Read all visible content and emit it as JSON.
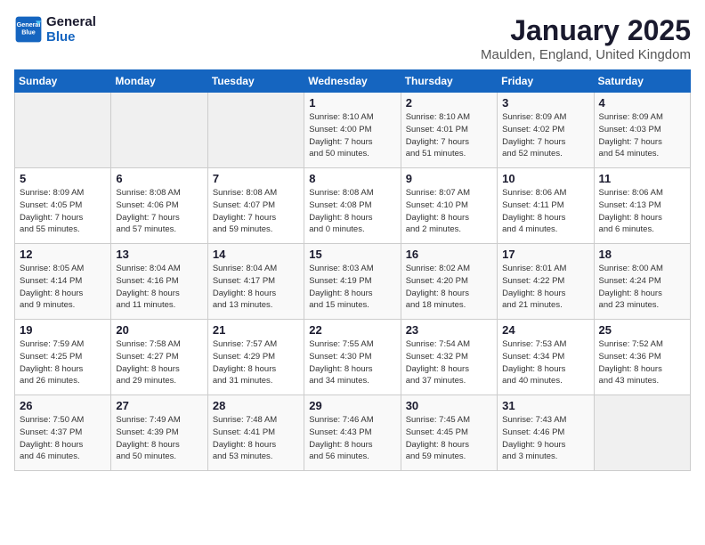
{
  "header": {
    "logo_line1": "General",
    "logo_line2": "Blue",
    "title": "January 2025",
    "subtitle": "Maulden, England, United Kingdom"
  },
  "days_of_week": [
    "Sunday",
    "Monday",
    "Tuesday",
    "Wednesday",
    "Thursday",
    "Friday",
    "Saturday"
  ],
  "weeks": [
    [
      {
        "day": "",
        "info": ""
      },
      {
        "day": "",
        "info": ""
      },
      {
        "day": "",
        "info": ""
      },
      {
        "day": "1",
        "info": "Sunrise: 8:10 AM\nSunset: 4:00 PM\nDaylight: 7 hours\nand 50 minutes."
      },
      {
        "day": "2",
        "info": "Sunrise: 8:10 AM\nSunset: 4:01 PM\nDaylight: 7 hours\nand 51 minutes."
      },
      {
        "day": "3",
        "info": "Sunrise: 8:09 AM\nSunset: 4:02 PM\nDaylight: 7 hours\nand 52 minutes."
      },
      {
        "day": "4",
        "info": "Sunrise: 8:09 AM\nSunset: 4:03 PM\nDaylight: 7 hours\nand 54 minutes."
      }
    ],
    [
      {
        "day": "5",
        "info": "Sunrise: 8:09 AM\nSunset: 4:05 PM\nDaylight: 7 hours\nand 55 minutes."
      },
      {
        "day": "6",
        "info": "Sunrise: 8:08 AM\nSunset: 4:06 PM\nDaylight: 7 hours\nand 57 minutes."
      },
      {
        "day": "7",
        "info": "Sunrise: 8:08 AM\nSunset: 4:07 PM\nDaylight: 7 hours\nand 59 minutes."
      },
      {
        "day": "8",
        "info": "Sunrise: 8:08 AM\nSunset: 4:08 PM\nDaylight: 8 hours\nand 0 minutes."
      },
      {
        "day": "9",
        "info": "Sunrise: 8:07 AM\nSunset: 4:10 PM\nDaylight: 8 hours\nand 2 minutes."
      },
      {
        "day": "10",
        "info": "Sunrise: 8:06 AM\nSunset: 4:11 PM\nDaylight: 8 hours\nand 4 minutes."
      },
      {
        "day": "11",
        "info": "Sunrise: 8:06 AM\nSunset: 4:13 PM\nDaylight: 8 hours\nand 6 minutes."
      }
    ],
    [
      {
        "day": "12",
        "info": "Sunrise: 8:05 AM\nSunset: 4:14 PM\nDaylight: 8 hours\nand 9 minutes."
      },
      {
        "day": "13",
        "info": "Sunrise: 8:04 AM\nSunset: 4:16 PM\nDaylight: 8 hours\nand 11 minutes."
      },
      {
        "day": "14",
        "info": "Sunrise: 8:04 AM\nSunset: 4:17 PM\nDaylight: 8 hours\nand 13 minutes."
      },
      {
        "day": "15",
        "info": "Sunrise: 8:03 AM\nSunset: 4:19 PM\nDaylight: 8 hours\nand 15 minutes."
      },
      {
        "day": "16",
        "info": "Sunrise: 8:02 AM\nSunset: 4:20 PM\nDaylight: 8 hours\nand 18 minutes."
      },
      {
        "day": "17",
        "info": "Sunrise: 8:01 AM\nSunset: 4:22 PM\nDaylight: 8 hours\nand 21 minutes."
      },
      {
        "day": "18",
        "info": "Sunrise: 8:00 AM\nSunset: 4:24 PM\nDaylight: 8 hours\nand 23 minutes."
      }
    ],
    [
      {
        "day": "19",
        "info": "Sunrise: 7:59 AM\nSunset: 4:25 PM\nDaylight: 8 hours\nand 26 minutes."
      },
      {
        "day": "20",
        "info": "Sunrise: 7:58 AM\nSunset: 4:27 PM\nDaylight: 8 hours\nand 29 minutes."
      },
      {
        "day": "21",
        "info": "Sunrise: 7:57 AM\nSunset: 4:29 PM\nDaylight: 8 hours\nand 31 minutes."
      },
      {
        "day": "22",
        "info": "Sunrise: 7:55 AM\nSunset: 4:30 PM\nDaylight: 8 hours\nand 34 minutes."
      },
      {
        "day": "23",
        "info": "Sunrise: 7:54 AM\nSunset: 4:32 PM\nDaylight: 8 hours\nand 37 minutes."
      },
      {
        "day": "24",
        "info": "Sunrise: 7:53 AM\nSunset: 4:34 PM\nDaylight: 8 hours\nand 40 minutes."
      },
      {
        "day": "25",
        "info": "Sunrise: 7:52 AM\nSunset: 4:36 PM\nDaylight: 8 hours\nand 43 minutes."
      }
    ],
    [
      {
        "day": "26",
        "info": "Sunrise: 7:50 AM\nSunset: 4:37 PM\nDaylight: 8 hours\nand 46 minutes."
      },
      {
        "day": "27",
        "info": "Sunrise: 7:49 AM\nSunset: 4:39 PM\nDaylight: 8 hours\nand 50 minutes."
      },
      {
        "day": "28",
        "info": "Sunrise: 7:48 AM\nSunset: 4:41 PM\nDaylight: 8 hours\nand 53 minutes."
      },
      {
        "day": "29",
        "info": "Sunrise: 7:46 AM\nSunset: 4:43 PM\nDaylight: 8 hours\nand 56 minutes."
      },
      {
        "day": "30",
        "info": "Sunrise: 7:45 AM\nSunset: 4:45 PM\nDaylight: 8 hours\nand 59 minutes."
      },
      {
        "day": "31",
        "info": "Sunrise: 7:43 AM\nSunset: 4:46 PM\nDaylight: 9 hours\nand 3 minutes."
      },
      {
        "day": "",
        "info": ""
      }
    ]
  ]
}
